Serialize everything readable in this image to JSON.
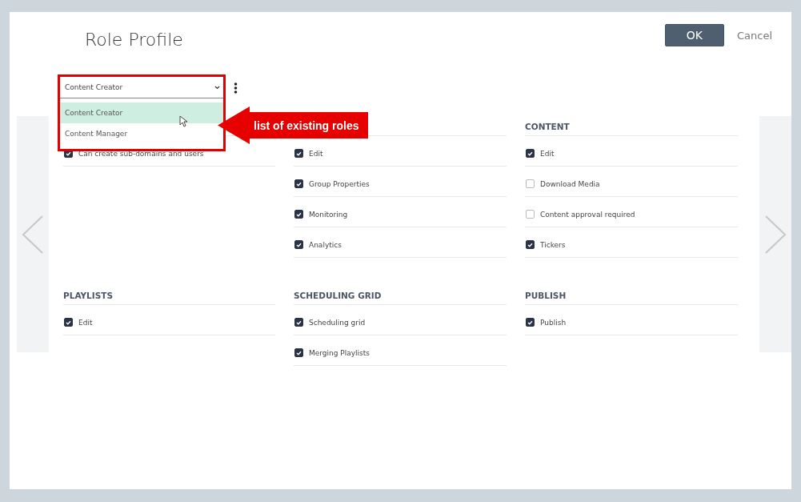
{
  "title": "Role Profile",
  "buttons": [
    {
      "label": "OK",
      "kind": "primary"
    },
    {
      "label": "Cancel",
      "kind": "link"
    }
  ],
  "role_select": {
    "value": "Content Creator",
    "options": [
      {
        "label": "Content Creator",
        "selected": true
      },
      {
        "label": "Content Manager",
        "selected": false
      }
    ]
  },
  "annotation": {
    "text": "list of existing roles"
  },
  "sections": [
    {
      "items": [
        {
          "label": "Can create sub-domains and users",
          "checked": true
        }
      ]
    },
    {
      "items": [
        {
          "label": "Edit",
          "checked": true
        },
        {
          "label": "Group Properties",
          "checked": true
        },
        {
          "label": "Monitoring",
          "checked": true
        },
        {
          "label": "Analytics",
          "checked": true
        }
      ]
    },
    {
      "title": "CONTENT",
      "items": [
        {
          "label": "Edit",
          "checked": true
        },
        {
          "label": "Download Media",
          "checked": false
        },
        {
          "label": "Content approval required",
          "checked": false
        },
        {
          "label": "Tickers",
          "checked": true
        }
      ]
    },
    {
      "title": "PLAYLISTS",
      "items": [
        {
          "label": "Edit",
          "checked": true
        }
      ]
    },
    {
      "title": "SCHEDULING GRID",
      "items": [
        {
          "label": "Scheduling grid",
          "checked": true
        },
        {
          "label": "Merging Playlists",
          "checked": true
        }
      ]
    },
    {
      "title": "PUBLISH",
      "items": [
        {
          "label": "Publish",
          "checked": true
        }
      ]
    }
  ]
}
